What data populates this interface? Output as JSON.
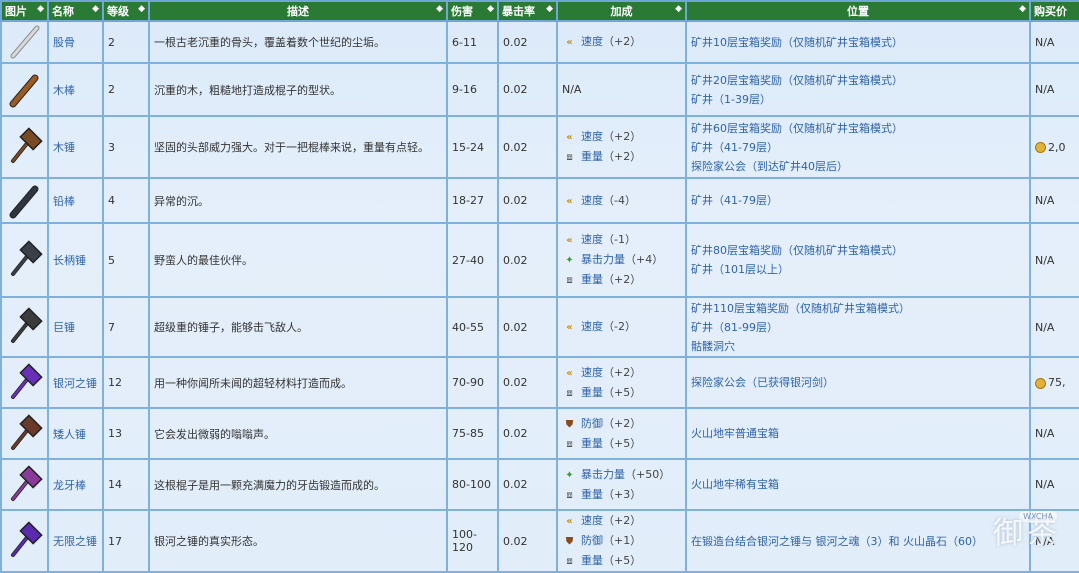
{
  "headers": [
    "图片",
    "名称",
    "等级",
    "描述",
    "伤害",
    "暴击率",
    "加成",
    "位置",
    "购买价"
  ],
  "rows": [
    {
      "name": "股骨",
      "level": "2",
      "desc": "一根古老沉重的骨头，覆盖着数个世纪的尘垢。",
      "damage": "6-11",
      "crit": "0.02",
      "bonuses": [
        {
          "icon": "speed-icon",
          "label": "速度",
          "val": "（+2）"
        }
      ],
      "loc": [
        "矿井10层宝箱奖励（仅随机矿井宝箱模式）"
      ],
      "price": "N/A",
      "color": "#d9d9d9"
    },
    {
      "name": "木棒",
      "level": "2",
      "desc": "沉重的木，粗糙地打造成棍子的型状。",
      "damage": "9-16",
      "crit": "0.02",
      "bonuses": [],
      "bonus_text": "N/A",
      "loc": [
        "矿井20层宝箱奖励（仅随机矿井宝箱模式）",
        "矿井（1-39层）"
      ],
      "price": "N/A",
      "color": "#9a5a22"
    },
    {
      "name": "木锤",
      "level": "3",
      "desc": "坚固的头部威力强大。对于一把棍棒来说，重量有点轻。",
      "damage": "15-24",
      "crit": "0.02",
      "bonuses": [
        {
          "icon": "speed-icon",
          "label": "速度",
          "val": "（+2）"
        },
        {
          "icon": "weight-icon",
          "label": "重量",
          "val": "（+2）"
        }
      ],
      "loc": [
        "矿井60层宝箱奖励（仅随机矿井宝箱模式）",
        "矿井（41-79层）",
        "探险家公会（到达矿井40层后）"
      ],
      "price": "2,0",
      "coin": true,
      "color": "#7a4a22"
    },
    {
      "name": "铅棒",
      "level": "4",
      "desc": "异常的沉。",
      "damage": "18-27",
      "crit": "0.02",
      "bonuses": [
        {
          "icon": "speed-icon",
          "label": "速度",
          "val": "（-4）"
        }
      ],
      "loc": [
        "矿井（41-79层）"
      ],
      "price": "N/A",
      "color": "#2e3440"
    },
    {
      "name": "长柄锤",
      "level": "5",
      "desc": "野蛮人的最佳伙伴。",
      "damage": "27-40",
      "crit": "0.02",
      "bonuses": [
        {
          "icon": "speed-icon",
          "label": "速度",
          "val": "（-1）"
        },
        {
          "icon": "crit-power-icon",
          "label": "暴击力量",
          "val": "（+4）"
        },
        {
          "icon": "weight-icon",
          "label": "重量",
          "val": "（+2）"
        }
      ],
      "loc": [
        "矿井80层宝箱奖励（仅随机矿井宝箱模式）",
        "矿井（101层以上）"
      ],
      "price": "N/A",
      "color": "#3a3f48"
    },
    {
      "name": "巨锤",
      "level": "7",
      "desc": "超级重的锤子，能够击飞敌人。",
      "damage": "40-55",
      "crit": "0.02",
      "bonuses": [
        {
          "icon": "speed-icon",
          "label": "速度",
          "val": "（-2）"
        }
      ],
      "loc": [
        "矿井110层宝箱奖励（仅随机矿井宝箱模式）",
        "矿井（81-99层）",
        "骷髅洞穴"
      ],
      "price": "N/A",
      "color": "#3b3b3b"
    },
    {
      "name": "银河之锤",
      "level": "12",
      "desc": "用一种你闻所未闻的超轻材料打造而成。",
      "damage": "70-90",
      "crit": "0.02",
      "bonuses": [
        {
          "icon": "speed-icon",
          "label": "速度",
          "val": "（+2）"
        },
        {
          "icon": "weight-icon",
          "label": "重量",
          "val": "（+5）"
        }
      ],
      "loc": [
        "探险家公会（已获得银河剑）"
      ],
      "price": "75,",
      "coin": true,
      "color": "#6a2fb8"
    },
    {
      "name": "矮人锤",
      "level": "13",
      "desc": "它会发出微弱的嗡嗡声。",
      "damage": "75-85",
      "crit": "0.02",
      "bonuses": [
        {
          "icon": "defense-icon",
          "label": "防御",
          "val": "（+2）"
        },
        {
          "icon": "weight-icon",
          "label": "重量",
          "val": "（+5）"
        }
      ],
      "loc": [
        "火山地牢普通宝箱"
      ],
      "price": "N/A",
      "color": "#6a3a2a"
    },
    {
      "name": "龙牙棒",
      "level": "14",
      "desc": "这根棍子是用一颗充满魔力的牙齿锻造而成的。",
      "damage": "80-100",
      "crit": "0.02",
      "bonuses": [
        {
          "icon": "crit-power-icon",
          "label": "暴击力量",
          "val": "（+50）"
        },
        {
          "icon": "weight-icon",
          "label": "重量",
          "val": "（+3）"
        }
      ],
      "loc": [
        "火山地牢稀有宝箱"
      ],
      "price": "N/A",
      "color": "#8a3a9a"
    },
    {
      "name": "无限之锤",
      "level": "17",
      "desc": "银河之锤的真实形态。",
      "damage": "100-120",
      "crit": "0.02",
      "bonuses": [
        {
          "icon": "speed-icon",
          "label": "速度",
          "val": "（+2）"
        },
        {
          "icon": "defense-icon",
          "label": "防御",
          "val": "（+1）"
        },
        {
          "icon": "weight-icon",
          "label": "重量",
          "val": "（+5）"
        }
      ],
      "loc": [
        "在锻造台结合银河之锤与 银河之魂（3）和 火山晶石（60）"
      ],
      "price": "N/A",
      "color": "#5a2ab0"
    }
  ],
  "watermark": "御茶",
  "watermark_small": "WXCHA"
}
